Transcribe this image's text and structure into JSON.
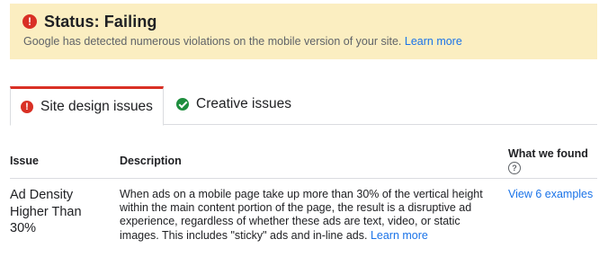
{
  "status": {
    "icon": "alert-circle-icon",
    "title": "Status: Failing",
    "message": "Google has detected numerous violations on the mobile version of your site.",
    "learn_more": "Learn more",
    "banner_color": "#fbeec1",
    "error_color": "#d93025"
  },
  "tabs": [
    {
      "label": "Site design issues",
      "icon": "alert-circle-icon",
      "active": true
    },
    {
      "label": "Creative issues",
      "icon": "check-circle-icon",
      "active": false
    }
  ],
  "table": {
    "headers": {
      "issue": "Issue",
      "description": "Description",
      "found": "What we found"
    },
    "rows": [
      {
        "issue": "Ad Density Higher Than 30%",
        "description": "When ads on a mobile page take up more than 30% of the vertical height within the main content portion of the page, the result is a disruptive ad experience, regardless of whether these ads are text, video, or static images. This includes \"sticky\" ads and in-line ads.",
        "learn_more": "Learn more",
        "found": "View 6 examples"
      }
    ]
  },
  "colors": {
    "link": "#1a73e8",
    "success": "#1e8e3e",
    "divider": "#dadce0"
  }
}
